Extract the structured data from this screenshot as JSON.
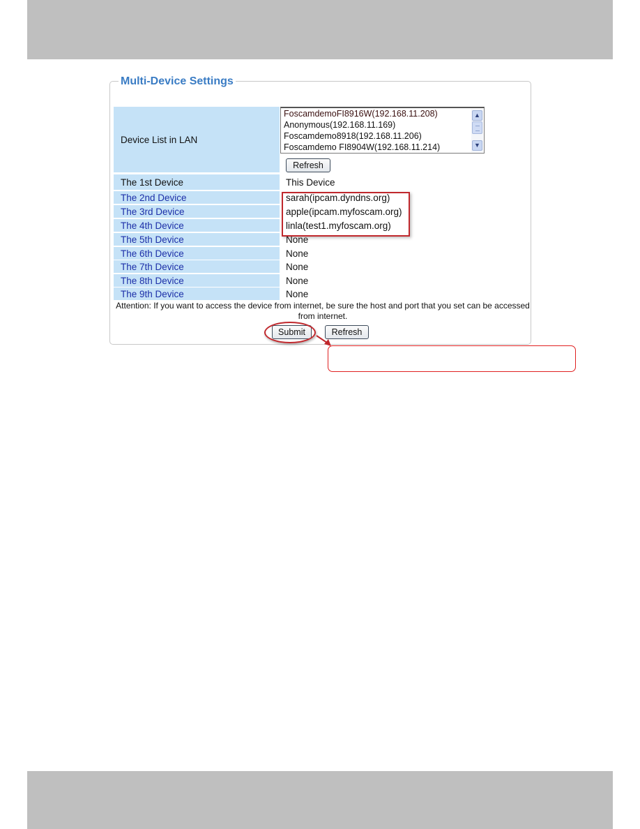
{
  "panel": {
    "title": "Multi-Device Settings"
  },
  "device_list": {
    "label": "Device List in LAN",
    "options": [
      "FoscamdemoFI8916W(192.168.11.208)",
      "Anonymous(192.168.11.169)",
      "Foscamdemo8918(192.168.11.206)",
      "Foscamdemo FI8904W(192.168.11.214)"
    ],
    "refresh_label": "Refresh"
  },
  "devices": [
    {
      "label": "The 1st Device",
      "value": "This Device"
    },
    {
      "label": "The 2nd Device",
      "value": "sarah(ipcam.dyndns.org)"
    },
    {
      "label": "The 3rd Device",
      "value": "apple(ipcam.myfoscam.org)"
    },
    {
      "label": "The 4th Device",
      "value": "linla(test1.myfoscam.org)"
    },
    {
      "label": "The 5th Device",
      "value": "None"
    },
    {
      "label": "The 6th Device",
      "value": "None"
    },
    {
      "label": "The 7th Device",
      "value": "None"
    },
    {
      "label": "The 8th Device",
      "value": "None"
    },
    {
      "label": "The 9th Device",
      "value": "None"
    }
  ],
  "attention": "Attention: If you want to access the device from internet, be sure the host and port that you set can be accessed from internet.",
  "actions": {
    "submit_label": "Submit",
    "refresh_label": "Refresh"
  },
  "colors": {
    "title": "#3a7cc4",
    "label_bg": "#c5e2f7",
    "label_link": "#1c2fa8",
    "annotation_red": "#c0282d",
    "band_gray": "#bfbfbf"
  }
}
